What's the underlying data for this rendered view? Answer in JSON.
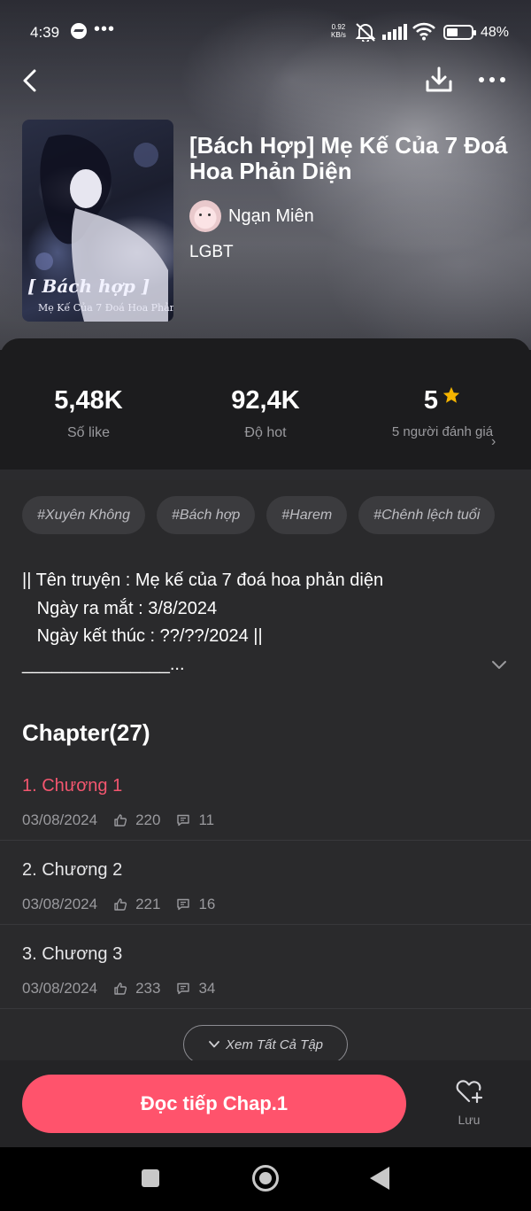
{
  "status_bar": {
    "time": "4:39",
    "menu_dots": "•••",
    "net_speed_value": "0.92",
    "net_speed_unit": "KB/s",
    "battery": "48%"
  },
  "header": {
    "back_icon": "chevron-left-icon",
    "download_icon": "download-icon",
    "more_icon": "more-horizontal-icon"
  },
  "book": {
    "title": "[Bách Hợp] Mẹ Kế Của 7 Đoá Hoa Phản Diện",
    "cover_text_line1": "[ Bách hợp ]",
    "cover_text_line2": "Mẹ Kế Của 7 Đoá Hoa Phản Diện",
    "author": "Ngạn Miên",
    "genre": "LGBT"
  },
  "stats": {
    "likes": "5,48K",
    "likes_label": "Số like",
    "hot": "92,4K",
    "hot_label": "Độ hot",
    "rating": "5",
    "rating_label": "5 người đánh giá",
    "star_color": "#f5b400"
  },
  "tags": [
    "#Xuyên Không",
    "#Bách hợp",
    "#Harem",
    "#Chênh lệch tuổi"
  ],
  "description": {
    "line1": "|| Tên truyện : Mẹ kế của 7 đoá hoa phản diện",
    "line2": "   Ngày ra mắt : 3/8/2024",
    "line3": "   Ngày kết thúc : ??/??/2024 ||",
    "line4": "_______________..."
  },
  "chapters": {
    "heading": "Chapter(27)",
    "items": [
      {
        "title": "1. Chương 1",
        "date": "03/08/2024",
        "likes": "220",
        "comments": "11"
      },
      {
        "title": "2. Chương 2",
        "date": "03/08/2024",
        "likes": "221",
        "comments": "16"
      },
      {
        "title": "3. Chương 3",
        "date": "03/08/2024",
        "likes": "233",
        "comments": "34"
      }
    ],
    "view_all_label": "Xem Tất Cả Tập"
  },
  "bottom_bar": {
    "read_button": "Đọc tiếp Chap.1",
    "save_label": "Lưu",
    "accent_color": "#ff536c"
  }
}
